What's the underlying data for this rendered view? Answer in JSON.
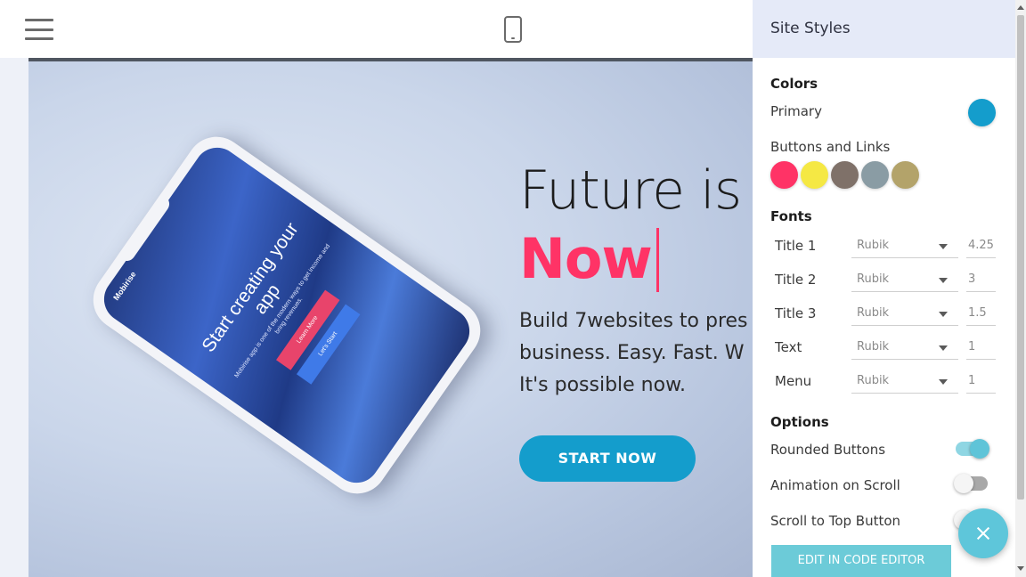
{
  "topbar": {
    "menu_icon": "hamburger-menu-icon",
    "device_icon": "mobile-phone-icon"
  },
  "hero": {
    "title_line1": "Future is",
    "title_line2": "Now",
    "text_line1": "Build 7websites to pres",
    "text_line2": "business. Easy. Fast. W",
    "text_line3": "It's possible now.",
    "cta_label": "START NOW",
    "accent_color": "#ff3366",
    "cta_color": "#149dcc",
    "mockup": {
      "brand": "Mobirise",
      "title": "Start creating your app",
      "subtitle": "Mobirise app is one of the modern ways to get income and bring revenues.",
      "button_primary": "Learn More",
      "button_secondary": "Let's Start"
    }
  },
  "panel": {
    "title": "Site Styles",
    "colors": {
      "heading": "Colors",
      "primary_label": "Primary",
      "primary_color": "#149dcc",
      "buttons_label": "Buttons and Links",
      "swatches": [
        "#ff3366",
        "#f5e844",
        "#7f7169",
        "#8a9ca4",
        "#b3a36a"
      ]
    },
    "fonts": {
      "heading": "Fonts",
      "rows": [
        {
          "name": "Title 1",
          "font": "Rubik",
          "size": "4.25"
        },
        {
          "name": "Title 2",
          "font": "Rubik",
          "size": "3"
        },
        {
          "name": "Title 3",
          "font": "Rubik",
          "size": "1.5"
        },
        {
          "name": "Text",
          "font": "Rubik",
          "size": "1"
        },
        {
          "name": "Menu",
          "font": "Rubik",
          "size": "1"
        }
      ]
    },
    "options": {
      "heading": "Options",
      "items": [
        {
          "label": "Rounded Buttons",
          "state": "on"
        },
        {
          "label": "Animation on Scroll",
          "state": "off"
        },
        {
          "label": "Scroll to Top Button",
          "state": "off"
        }
      ]
    },
    "code_editor_label": "EDIT IN CODE EDITOR",
    "close_icon": "close-icon"
  }
}
